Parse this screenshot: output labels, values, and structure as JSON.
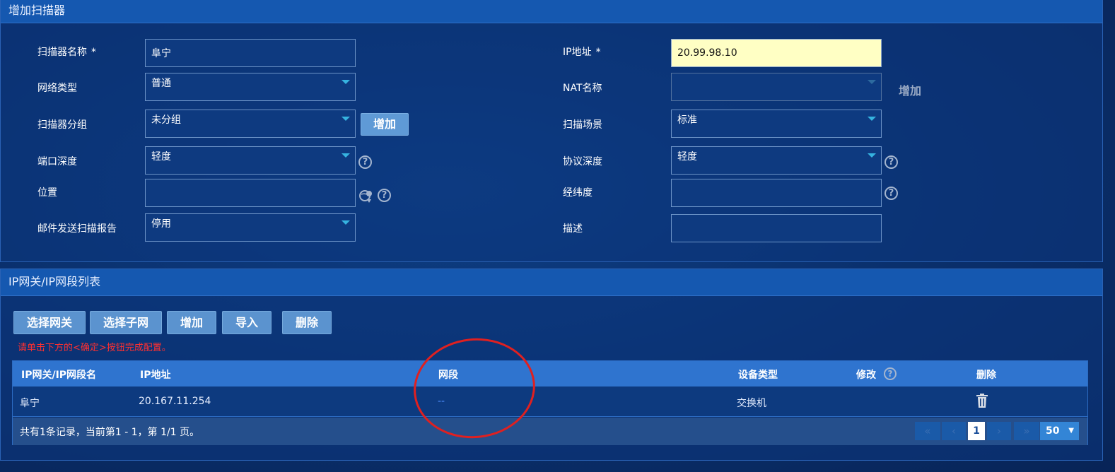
{
  "scanner_panel": {
    "title": "增加扫描器",
    "left_fields": {
      "name_label": "扫描器名称",
      "name_value": "阜宁",
      "network_type_label": "网络类型",
      "network_type_value": "普通",
      "group_label": "扫描器分组",
      "group_value": "未分组",
      "group_add_button": "增加",
      "port_depth_label": "端口深度",
      "port_depth_value": "轻度",
      "location_label": "位置",
      "location_value": "",
      "mail_report_label": "邮件发送扫描报告",
      "mail_report_value": "停用"
    },
    "right_fields": {
      "ip_label": "IP地址",
      "ip_value": "20.99.98.10",
      "nat_label": "NAT名称",
      "nat_value": "",
      "nat_add_link": "增加",
      "scene_label": "扫描场景",
      "scene_value": "标准",
      "protocol_depth_label": "协议深度",
      "protocol_depth_value": "轻度",
      "latlng_label": "经纬度",
      "latlng_value": "",
      "desc_label": "描述",
      "desc_value": ""
    },
    "required_mark": "*"
  },
  "ip_panel": {
    "title": "IP网关/IP网段列表",
    "toolbar": {
      "select_gateway": "选择网关",
      "select_subnet": "选择子网",
      "add": "增加",
      "import": "导入",
      "delete": "删除"
    },
    "warning": "请单击下方的<确定>按钮完成配置。",
    "table": {
      "headers": [
        "IP网关/IP网段名",
        "IP地址",
        "网段",
        "设备类型",
        "修改",
        "删除"
      ],
      "rows": [
        {
          "name": "阜宁",
          "ip": "20.167.11.254",
          "segment": "--",
          "device_type": "交换机"
        }
      ]
    },
    "footer": {
      "summary": "共有1条记录，当前第1 - 1，第 1/1 页。",
      "current_page": "1",
      "page_size": "50",
      "first": "«",
      "prev": "‹",
      "next": "›",
      "last": "»"
    }
  },
  "colors": {
    "header_bar": "#1558b0",
    "button": "#5f9ad6",
    "highlight_input": "#ffffc4",
    "warning": "#ff3030",
    "annotation": "#e02020"
  },
  "icons": {
    "help": "help-icon",
    "globe": "globe-location-icon",
    "trash": "trash-icon",
    "dropdown": "chevron-down-icon"
  }
}
